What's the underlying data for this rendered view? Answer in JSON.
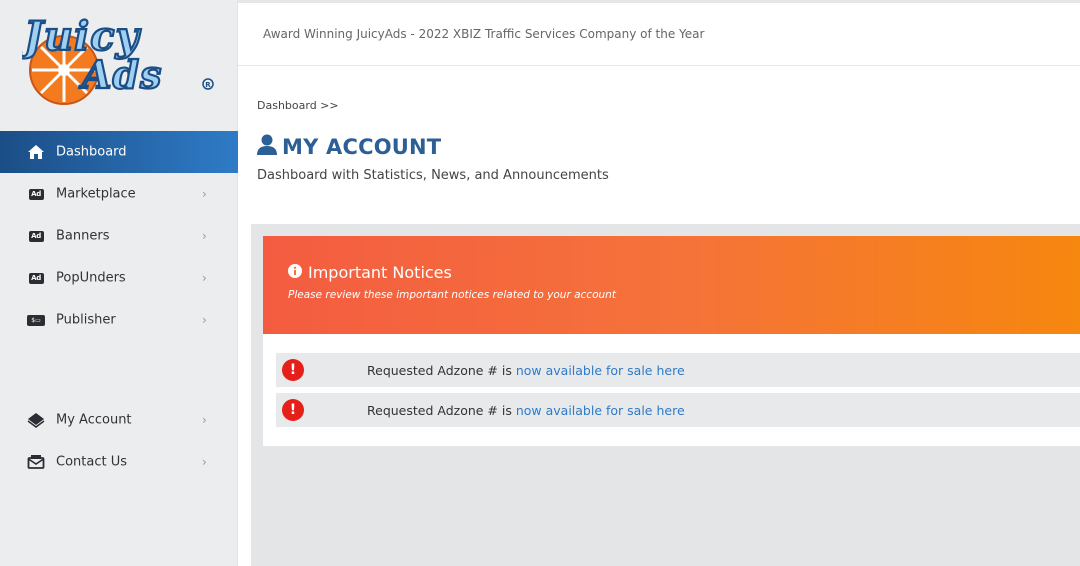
{
  "brand": {
    "logo_line1": "Juicy",
    "logo_line2": "Ads",
    "colors": {
      "blue": "#2f7bc7",
      "orange": "#f6870f",
      "dark_blue": "#1b4e86"
    }
  },
  "header": {
    "award_text": "Award Winning JuicyAds - 2022 XBIZ Traffic Services Company of the Year"
  },
  "sidebar": {
    "items": [
      {
        "label": "Dashboard",
        "icon": "home-icon",
        "active": true,
        "chevron": ""
      },
      {
        "label": "Marketplace",
        "icon": "ad-badge-icon",
        "chevron": "›"
      },
      {
        "label": "Banners",
        "icon": "ad-badge-icon",
        "chevron": "›"
      },
      {
        "label": "PopUnders",
        "icon": "ad-badge-icon",
        "chevron": "›"
      },
      {
        "label": "Publisher",
        "icon": "money-badge-icon",
        "chevron": "›"
      },
      {
        "label": "My Account",
        "icon": "diamond-icon",
        "chevron": "›"
      },
      {
        "label": "Contact Us",
        "icon": "envelope-icon",
        "chevron": "›"
      }
    ],
    "badges": {
      "ad": "Ad",
      "money": "$▭"
    }
  },
  "page": {
    "breadcrumb": "Dashboard >>",
    "title": "MY ACCOUNT",
    "subtitle": "Dashboard with Statistics, News, and Announcements"
  },
  "notices": {
    "title": "Important Notices",
    "subtitle": "Please review these important notices related to your account",
    "items": [
      {
        "prefix": "Requested Adzone # is ",
        "link": "now available for sale here"
      },
      {
        "prefix": "Requested Adzone # is ",
        "link": "now available for sale here"
      }
    ]
  }
}
